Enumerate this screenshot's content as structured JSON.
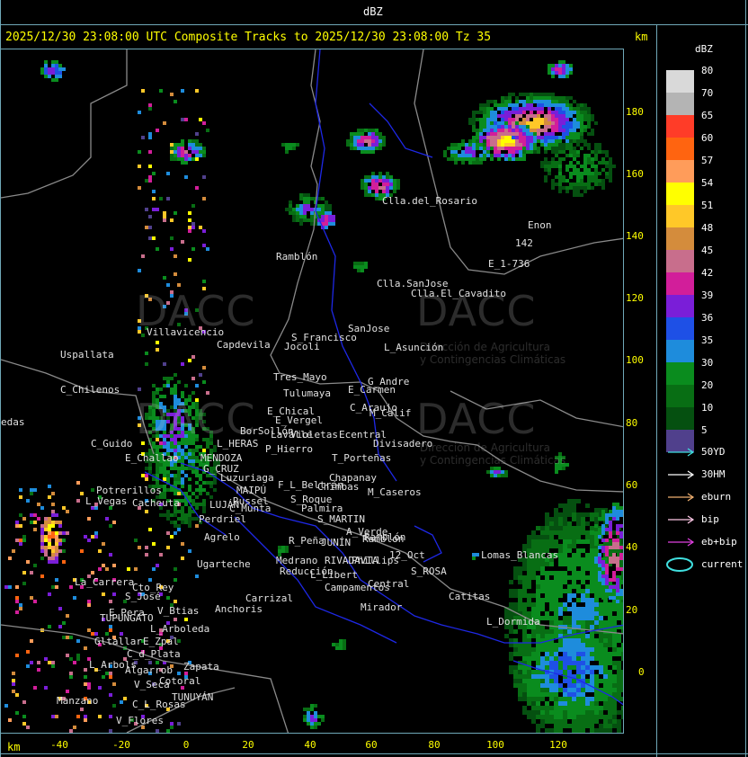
{
  "header": {
    "unit": "dBZ"
  },
  "title": "2025/12/30 23:08:00 UTC Composite Tracks to 2025/12/30 23:08:00 Tz 35",
  "axis": {
    "unit_top": "km",
    "unit_bottom": "km",
    "y_ticks": [
      "180",
      "160",
      "140",
      "120",
      "100",
      "80",
      "60",
      "40",
      "20",
      "0"
    ],
    "x_ticks": [
      "-40",
      "-20",
      "0",
      "20",
      "40",
      "60",
      "80",
      "100",
      "120"
    ]
  },
  "legend": {
    "title": "dBZ",
    "levels": [
      {
        "label": "80",
        "color": "#d9d9d9"
      },
      {
        "label": "70",
        "color": "#b4b4b4"
      },
      {
        "label": "65",
        "color": "#ff3c28"
      },
      {
        "label": "60",
        "color": "#ff6410"
      },
      {
        "label": "57",
        "color": "#ff9c5a"
      },
      {
        "label": "54",
        "color": "#ffff00"
      },
      {
        "label": "51",
        "color": "#ffc828"
      },
      {
        "label": "48",
        "color": "#d48c3c"
      },
      {
        "label": "45",
        "color": "#c86e8c"
      },
      {
        "label": "42",
        "color": "#d21e9a"
      },
      {
        "label": "39",
        "color": "#7a1ed8"
      },
      {
        "label": "36",
        "color": "#1e50e6"
      },
      {
        "label": "35",
        "color": "#1e8cdc"
      },
      {
        "label": "30",
        "color": "#0a8c1e"
      },
      {
        "label": "20",
        "color": "#086e14"
      },
      {
        "label": "10",
        "color": "#055010"
      },
      {
        "label": "5",
        "color": "#50408c"
      }
    ],
    "tracks": [
      {
        "label": "50YD",
        "color": "#40e0e0"
      },
      {
        "label": "30HM",
        "color": "#ffffff"
      },
      {
        "label": "eburn",
        "color": "#f0b070"
      },
      {
        "label": "bip",
        "color": "#ffc8e6"
      },
      {
        "label": "eb+bip",
        "color": "#e040e0"
      },
      {
        "label": "current",
        "color": "#40e0e0"
      }
    ]
  },
  "watermark": {
    "text": "DACC",
    "sub1": "Dirección de Agricultura",
    "sub2": "y Contingencias Climáticas"
  },
  "places": [
    "Clla.del_Rosario",
    "Enon",
    "142",
    "E_1-736",
    "Ramblón",
    "Clla.SanJose",
    "Clla.El_Cavadito",
    "Villavicencio",
    "Capdevila",
    "S_Francisco",
    "Jocoli",
    "SanJose",
    "L_Asunción",
    "Uspallata",
    "C_Chilenos",
    "Tres_Mayo",
    "Tulumaya",
    "E_Carmen",
    "G_Andre",
    "edas",
    "E_Chical",
    "E_Vergel",
    "C_Araujo",
    "M_Calif",
    "BorSollón",
    "Lavalle",
    "Violetas",
    "Ecentral",
    "Divisadero",
    "C_Guido",
    "L_HERAS",
    "P_Hierro",
    "T_Porteñas",
    "E_Challao",
    "MENDOZA",
    "G_CRUZ",
    "Chapanay",
    "Luzuriaga",
    "F_L_Beltrán",
    "Chimbas",
    "M_Caseros",
    "Potrerillos",
    "Cacheuta",
    "MAIPÚ",
    "Russel",
    "L_Vegas",
    "LUJÁN",
    "C_Munta",
    "S_Roque",
    "Palmira",
    "S_MARTIN",
    "Perdriel",
    "A_Verde",
    "Ramblón",
    "Agrelo",
    "R_Peña",
    "JUNÍN",
    "12_Oct",
    "Lomas_Blancas",
    "Ugarteche",
    "Medrano",
    "RIVADAVIA",
    "Phillips",
    "Reducción",
    "S_ROSA",
    "L_Libert",
    "La_Carrera",
    "Cto_Rey",
    "Campamentos",
    "Central",
    "Catitas",
    "S_José",
    "Carrizal",
    "E_Pera",
    "V_Btias",
    "Anchoris",
    "Mirador",
    "TUPUNGATO",
    "L_Dormida",
    "L_Arboleda",
    "Gltallar",
    "E_Zpal",
    "C_d_Plata",
    "L_Arbols",
    "Zapata",
    "Algarrob",
    "V_Seca",
    "Cotoral",
    "Manzano",
    "TUNUYÁN",
    "C_L_Rosas",
    "V_Flores",
    "Ramblon"
  ]
}
